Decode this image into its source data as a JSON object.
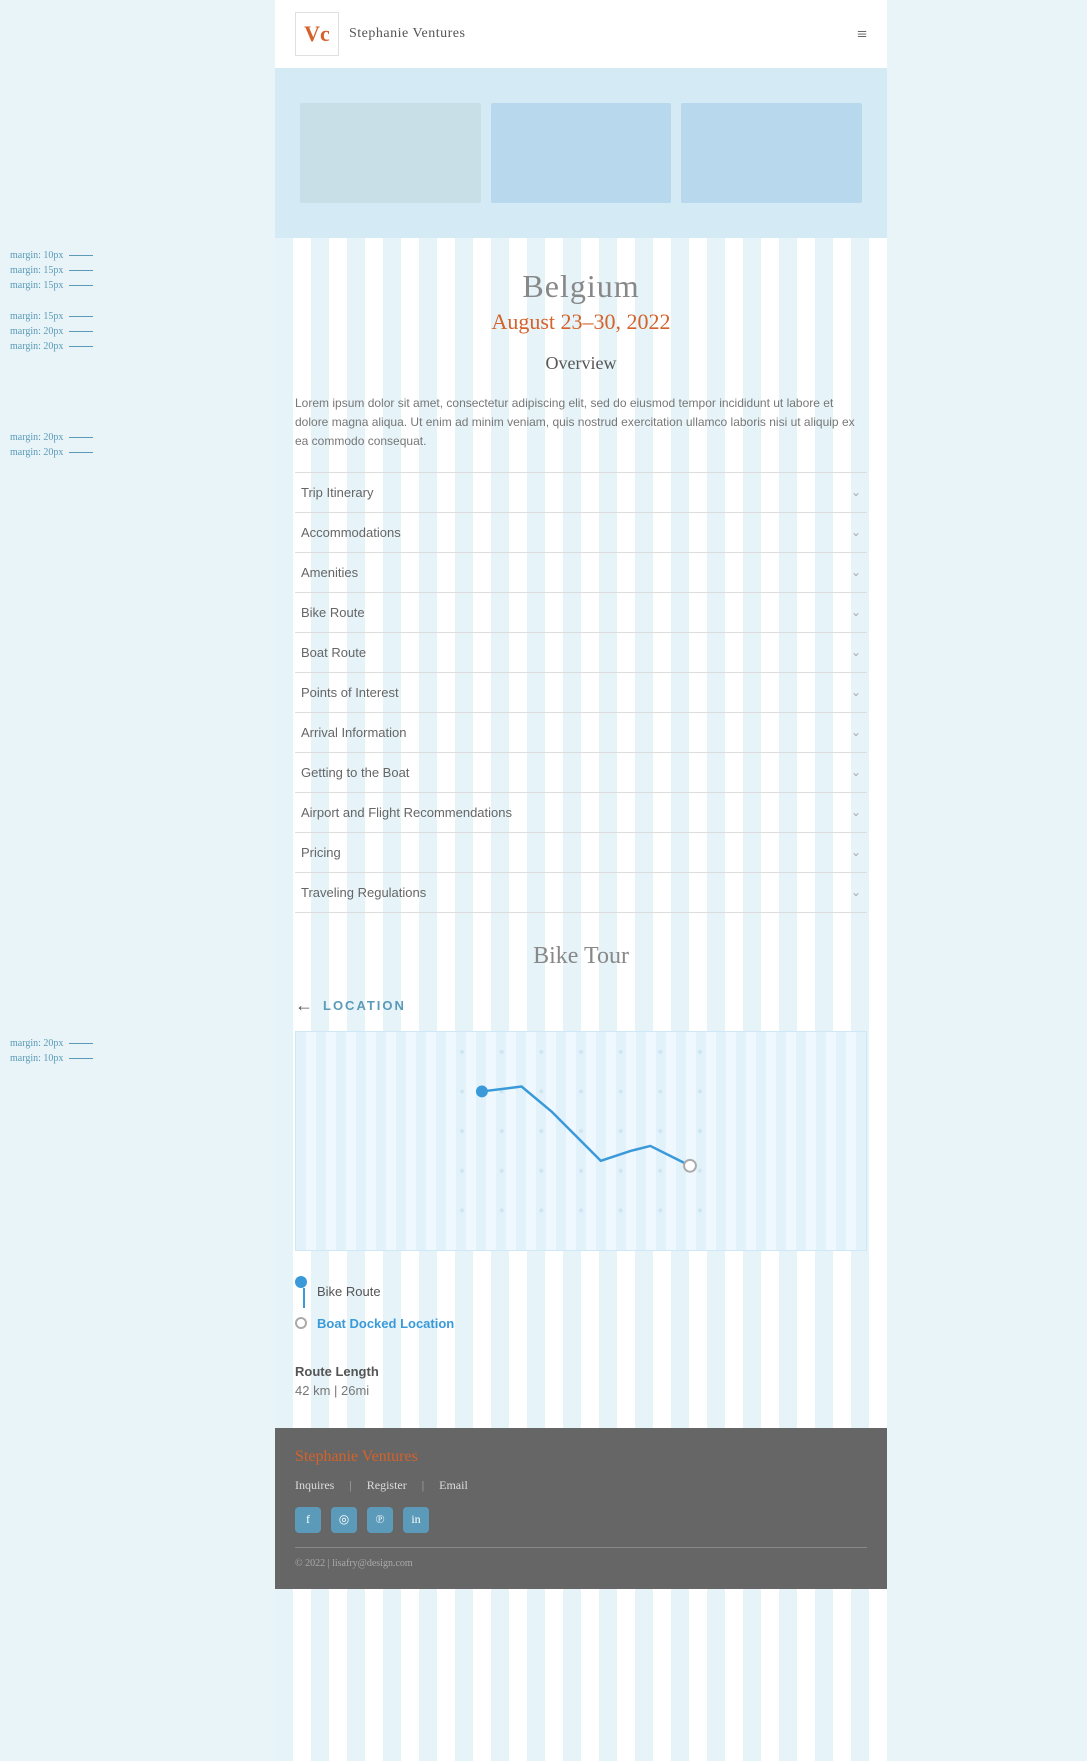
{
  "header": {
    "logo_text": "Vc",
    "site_name": "Stephanie Ventures",
    "hamburger": "≡"
  },
  "hero": {
    "images": [
      "img1",
      "img2",
      "img3"
    ]
  },
  "title_section": {
    "destination": "Belgium",
    "dates": "August 23–30, 2022",
    "overview_heading": "Overview",
    "overview_text": "Lorem ipsum dolor sit amet, consectetur adipiscing elit, sed do eiusmod tempor incididunt ut labore et dolore magna aliqua. Ut enim ad minim veniam, quis nostrud exercitation ullamco laboris nisi ut aliquip ex ea commodo consequat."
  },
  "accordion": {
    "items": [
      {
        "label": "Trip Itinerary",
        "expanded": false
      },
      {
        "label": "Accommodations",
        "expanded": false
      },
      {
        "label": "Amenities",
        "expanded": false
      },
      {
        "label": "Bike Route",
        "expanded": false
      },
      {
        "label": "Boat Route",
        "expanded": false
      },
      {
        "label": "Points of Interest",
        "expanded": false
      },
      {
        "label": "Arrival Information",
        "expanded": false
      },
      {
        "label": "Getting to the Boat",
        "expanded": false
      },
      {
        "label": "Airport and Flight Recommendations",
        "expanded": false
      },
      {
        "label": "Pricing",
        "expanded": false
      },
      {
        "label": "Traveling Regulations",
        "expanded": false
      }
    ]
  },
  "bike_tour": {
    "title": "Bike Tour",
    "location_label": "LOCATION",
    "back_arrow": "←"
  },
  "legend": {
    "items": [
      {
        "type": "filled",
        "label": "Bike Route"
      },
      {
        "type": "outline",
        "label": "Boat Docked Location"
      }
    ]
  },
  "route": {
    "label": "Route Length",
    "value": "42 km | 26mi"
  },
  "footer": {
    "brand": "Stephanie Ventures",
    "links": [
      "Inquires",
      "|",
      "Register",
      "|",
      "Email"
    ],
    "social_icons": [
      "f",
      "◎",
      "℗",
      "in"
    ],
    "copyright": "© 2022  |  lisafry@design.com"
  },
  "annotations": {
    "items": [
      "margin: 10px",
      "margin: 15px",
      "margin: 15px",
      "margin: 15px",
      "margin: 20px",
      "margin: 20px",
      "margin: 20px",
      "margin: 20px",
      "margin: 20px",
      "margin: 10px"
    ]
  }
}
